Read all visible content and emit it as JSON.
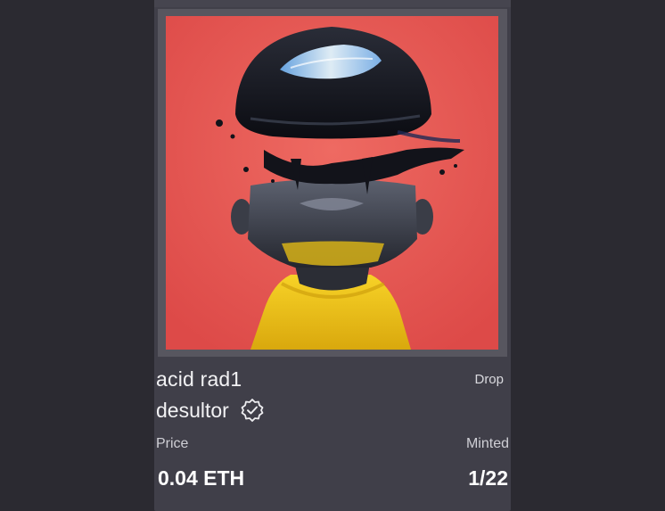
{
  "card": {
    "title": "acid rad1",
    "type_label": "Drop",
    "creator": "desultor",
    "price_label": "Price",
    "price_value": "0.04 ETH",
    "minted_label": "Minted",
    "minted_value": "1/22"
  },
  "icons": {
    "verified": "verified-badge-icon"
  },
  "colors": {
    "page_background": "#2b2a31",
    "card_background": "#403f49",
    "artwork_background": "#e9534f",
    "sweater": "#f2c518"
  }
}
